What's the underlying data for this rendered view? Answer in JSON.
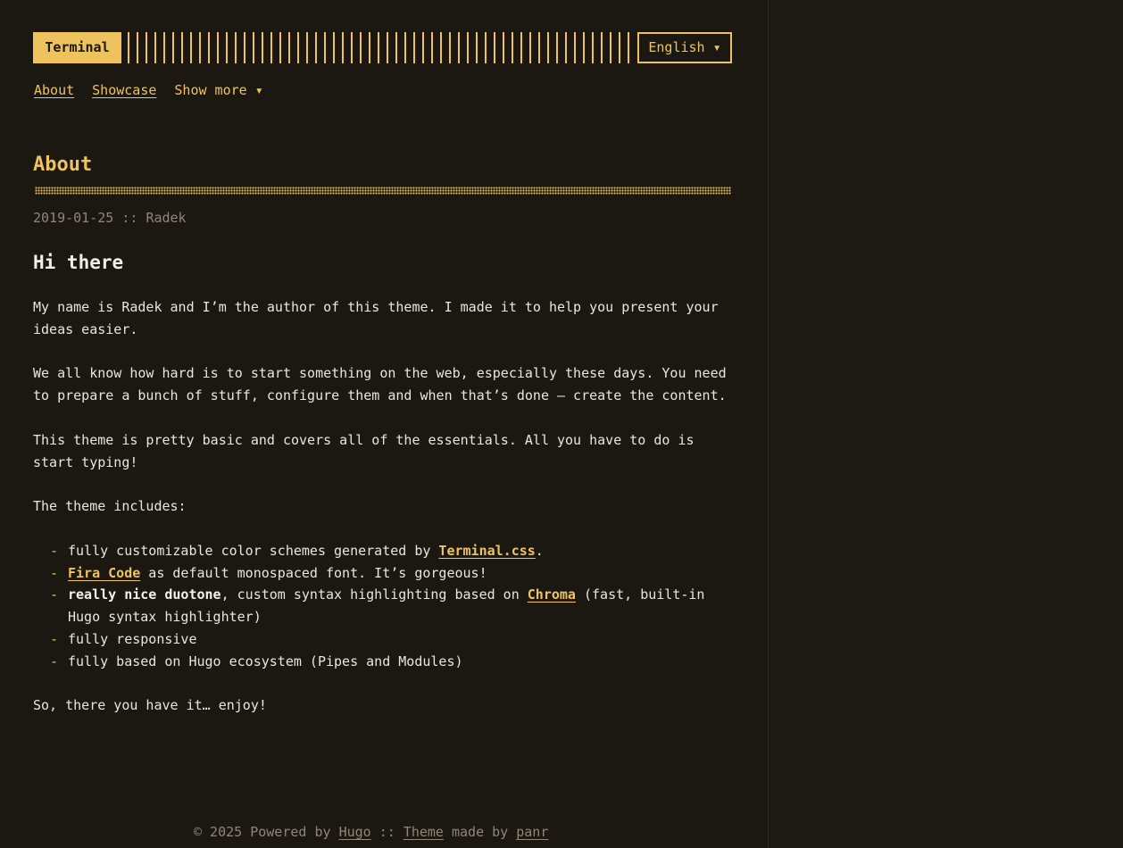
{
  "header": {
    "logo": "Terminal",
    "language": "English ▾"
  },
  "nav": {
    "items": [
      "About",
      "Showcase"
    ],
    "more": "Show more ▾"
  },
  "post": {
    "title": "About",
    "date": "2019-01-25",
    "separator": "::",
    "author": "Radek",
    "heading": "Hi there",
    "p1": "My name is Radek and I’m the author of this theme. I made it to help you present your ideas easier.",
    "p2": "We all know how hard is to start something on the web, especially these days. You need to prepare a bunch of stuff, configure them and when that’s done — create the content.",
    "p3": "This theme is pretty basic and covers all of the essentials. All you have to do is start typing!",
    "p4": "The theme includes:",
    "list": {
      "i1_pre": "fully customizable color schemes generated by ",
      "i1_link": "Terminal.css",
      "i1_post": ".",
      "i2_link": "Fira Code",
      "i2_post": " as default monospaced font. It’s gorgeous!",
      "i3_bold": "really nice duotone",
      "i3_mid": ", custom syntax highlighting based on ",
      "i3_link": "Chroma",
      "i3_post": " (fast, built-in Hugo syntax highlighter)",
      "i4": "fully responsive",
      "i5": "fully based on Hugo ecosystem (Pipes and Modules)"
    },
    "p5": "So, there you have it… enjoy!"
  },
  "footer": {
    "copyright": "© 2025 Powered by ",
    "hugo": "Hugo",
    "sep": " :: ",
    "theme": "Theme",
    "made_by": " made by ",
    "author": "panr"
  },
  "colors": {
    "accent": "#eec35e",
    "background": "#1b1811",
    "text": "#e8e6df",
    "muted": "#8c877a"
  }
}
